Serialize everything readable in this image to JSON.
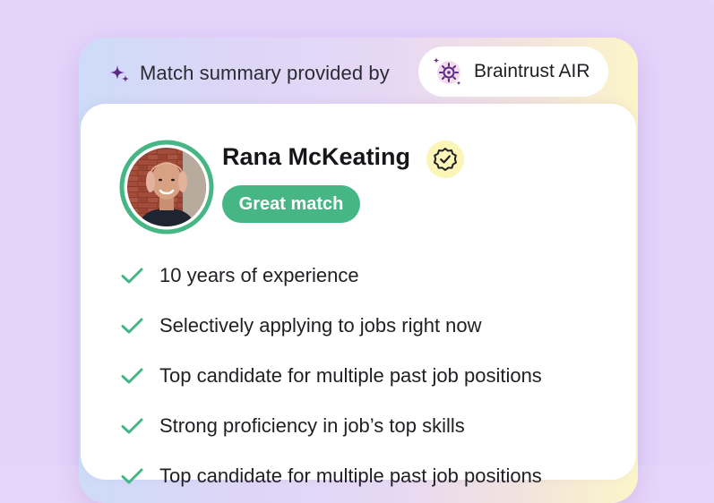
{
  "summary": {
    "label": "Match summary provided by",
    "brand": "Braintrust AIR"
  },
  "candidate": {
    "name": "Rana McKeating",
    "match_label": "Great match",
    "verified": true,
    "match_ring_color": "#47b685"
  },
  "highlights": [
    "10 years of experience",
    "Selectively applying to jobs right now",
    "Top candidate for multiple past job positions",
    "Strong proficiency in job’s top skills",
    "Top candidate for multiple past job positions"
  ],
  "colors": {
    "accent_green": "#47b685",
    "brand_purple": "#5b2a86",
    "badge_yellow": "#fbf6b8"
  },
  "icons": {
    "summary": "sparkle-icon",
    "brand": "braintrust-air-logo-icon",
    "verified": "verified-badge-icon",
    "list": "check-icon"
  }
}
